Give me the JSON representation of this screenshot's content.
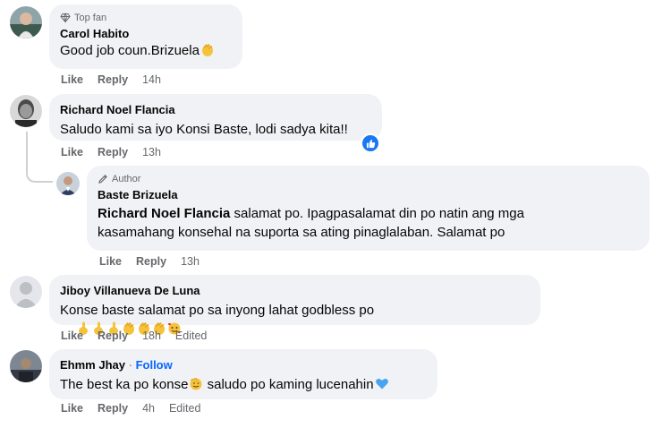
{
  "comments": [
    {
      "badge": "Top fan",
      "badge_icon": "diamond-icon",
      "name": "Carol Habito",
      "text": "Good job coun.Brizuela",
      "emojis": [
        "clap"
      ],
      "like": "Like",
      "reply": "Reply",
      "time": "14h"
    },
    {
      "name": "Richard Noel Flancia",
      "text": "Saludo kami sa iyo Konsi Baste, lodi sadya kita!!",
      "reaction": "thumbs-up",
      "like": "Like",
      "reply": "Reply",
      "time": "13h"
    },
    {
      "badge": "Author",
      "badge_icon": "pencil-icon",
      "name": "Baste Brizuela",
      "mention": "Richard Noel Flancia",
      "text": " salamat po. Ipagpasalamat din po natin ang mga kasamahang konsehal na suporta sa ating pinaglalaban. Salamat po",
      "like": "Like",
      "reply": "Reply",
      "time": "13h"
    },
    {
      "name": "Jiboy Villanueva De Luna",
      "text": "Konse baste salamat po sa inyong lahat godbless po",
      "emojis": [
        "finger",
        "finger",
        "finger",
        "clap",
        "clap",
        "clap",
        "heart-face"
      ],
      "like": "Like",
      "reply": "Reply",
      "time": "18h",
      "edited": "Edited"
    },
    {
      "name": "Ehmm Jhay",
      "separator": "·",
      "follow": "Follow",
      "text": "The best ka po konse",
      "text2": " saludo po kaming lucenahin",
      "emojis": [
        "salute"
      ],
      "emojis2": [
        "blue-heart"
      ],
      "like": "Like",
      "reply": "Reply",
      "time": "4h",
      "edited": "Edited"
    }
  ],
  "colors": {
    "bubble": "#f0f2f5",
    "meta": "#65676b",
    "link": "#0866ff",
    "like_blue": "#1877f2"
  }
}
